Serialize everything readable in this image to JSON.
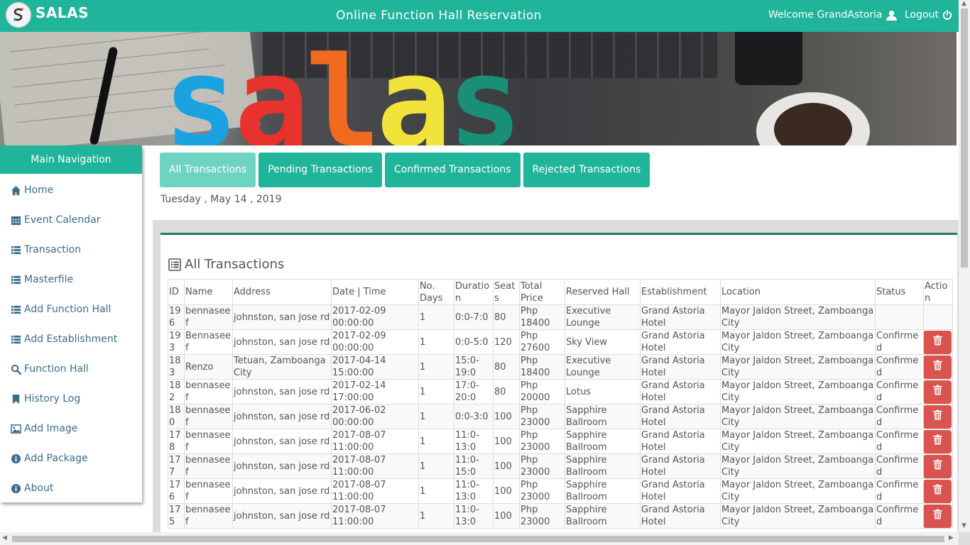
{
  "header": {
    "brand": "SALAS",
    "title": "Online Function Hall Reservation",
    "welcome": "Welcome GrandAstoria",
    "logout": "Logout"
  },
  "banner": {
    "letters": [
      {
        "char": "s",
        "color": "#1aa3e0"
      },
      {
        "char": "a",
        "color": "#e8322e"
      },
      {
        "char": "l",
        "color": "#f06b1f"
      },
      {
        "char": "a",
        "color": "#f2e33a"
      },
      {
        "char": "s",
        "color": "#1a8f77"
      }
    ]
  },
  "sidebar": {
    "heading": "Main Navigation",
    "items": [
      {
        "label": "Home",
        "icon": "home-icon"
      },
      {
        "label": "Event Calendar",
        "icon": "calendar-icon"
      },
      {
        "label": "Transaction",
        "icon": "list-icon"
      },
      {
        "label": "Masterfile",
        "icon": "list-icon"
      },
      {
        "label": "Add Function Hall",
        "icon": "list-icon"
      },
      {
        "label": "Add Establishment",
        "icon": "list-icon"
      },
      {
        "label": "Function Hall",
        "icon": "search-icon"
      },
      {
        "label": "History Log",
        "icon": "bookmark-icon"
      },
      {
        "label": "Add Image",
        "icon": "image-icon"
      },
      {
        "label": "Add Package",
        "icon": "info-icon"
      },
      {
        "label": "About",
        "icon": "info-icon"
      }
    ]
  },
  "tabs": [
    {
      "label": "All Transactions",
      "active": true
    },
    {
      "label": "Pending Transactions",
      "active": false
    },
    {
      "label": "Confirmed Transactions",
      "active": false
    },
    {
      "label": "Rejected Transactions",
      "active": false
    }
  ],
  "date": "Tuesday , May 14 , 2019",
  "panel": {
    "title": "All Transactions"
  },
  "table": {
    "columns": [
      "ID",
      "Name",
      "Address",
      "Date | Time",
      "No. Days",
      "Duration",
      "Seats",
      "Total Price",
      "Reserved Hall",
      "Establishment",
      "Location",
      "Status",
      "Action"
    ],
    "rows": [
      [
        "196",
        "bennaseef",
        "johnston, san jose rd",
        "2017-02-09 00:00:00",
        "1",
        "0:0-7:0",
        "80",
        "Php 18400",
        "Executive Lounge",
        "Grand Astoria Hotel",
        "Mayor Jaldon Street, Zamboanga City",
        "",
        ""
      ],
      [
        "193",
        "Bennaseef",
        "johnston, san jose rd",
        "2017-02-09 00:00:00",
        "1",
        "0:0-5:0",
        "120",
        "Php 27600",
        "Sky View",
        "Grand Astoria Hotel",
        "Mayor Jaldon Street, Zamboanga City",
        "Confirmed",
        "delete"
      ],
      [
        "183",
        "Renzo",
        "Tetuan, Zamboanga City",
        "2017-04-14 15:00:00",
        "1",
        "15:0-19:0",
        "80",
        "Php 18400",
        "Executive Lounge",
        "Grand Astoria Hotel",
        "Mayor Jaldon Street, Zamboanga City",
        "Confirmed",
        "delete"
      ],
      [
        "182",
        "bennaseef",
        "johnston, san jose rd",
        "2017-02-14 17:00:00",
        "1",
        "17:0-20:0",
        "80",
        "Php 20000",
        "Lotus",
        "Grand Astoria Hotel",
        "Mayor Jaldon Street, Zamboanga City",
        "Confirmed",
        "delete"
      ],
      [
        "180",
        "bennaseef",
        "johnston, san jose rd",
        "2017-06-02 00:00:00",
        "1",
        "0:0-3:0",
        "100",
        "Php 23000",
        "Sapphire Ballroom",
        "Grand Astoria Hotel",
        "Mayor Jaldon Street, Zamboanga City",
        "Confirmed",
        "delete"
      ],
      [
        "178",
        "bennaseef",
        "johnston, san jose rd",
        "2017-08-07 11:00:00",
        "1",
        "11:0-13:0",
        "100",
        "Php 23000",
        "Sapphire Ballroom",
        "Grand Astoria Hotel",
        "Mayor Jaldon Street, Zamboanga City",
        "Confirmed",
        "delete"
      ],
      [
        "177",
        "bennaseef",
        "johnston, san jose rd",
        "2017-08-07 11:00:00",
        "1",
        "11:0-15:0",
        "100",
        "Php 23000",
        "Sapphire Ballroom",
        "Grand Astoria Hotel",
        "Mayor Jaldon Street, Zamboanga City",
        "Confirmed",
        "delete"
      ],
      [
        "176",
        "bennaseef",
        "johnston, san jose rd",
        "2017-08-07 11:00:00",
        "1",
        "11:0-13:0",
        "100",
        "Php 23000",
        "Sapphire Ballroom",
        "Grand Astoria Hotel",
        "Mayor Jaldon Street, Zamboanga City",
        "Confirmed",
        "delete"
      ],
      [
        "175",
        "bennaseef",
        "johnston, san jose rd",
        "2017-08-07 11:00:00",
        "1",
        "11:0-13:0",
        "100",
        "Php 23000",
        "Sapphire Ballroom",
        "Grand Astoria Hotel",
        "Mayor Jaldon Street, Zamboanga City",
        "Confirmed",
        "delete"
      ]
    ]
  },
  "colors": {
    "primary": "#20b49a",
    "tab_active": "#6fd3c1",
    "nav_text": "#3a6d8c",
    "danger": "#d9534f",
    "panel_border": "#1b7a6a"
  }
}
